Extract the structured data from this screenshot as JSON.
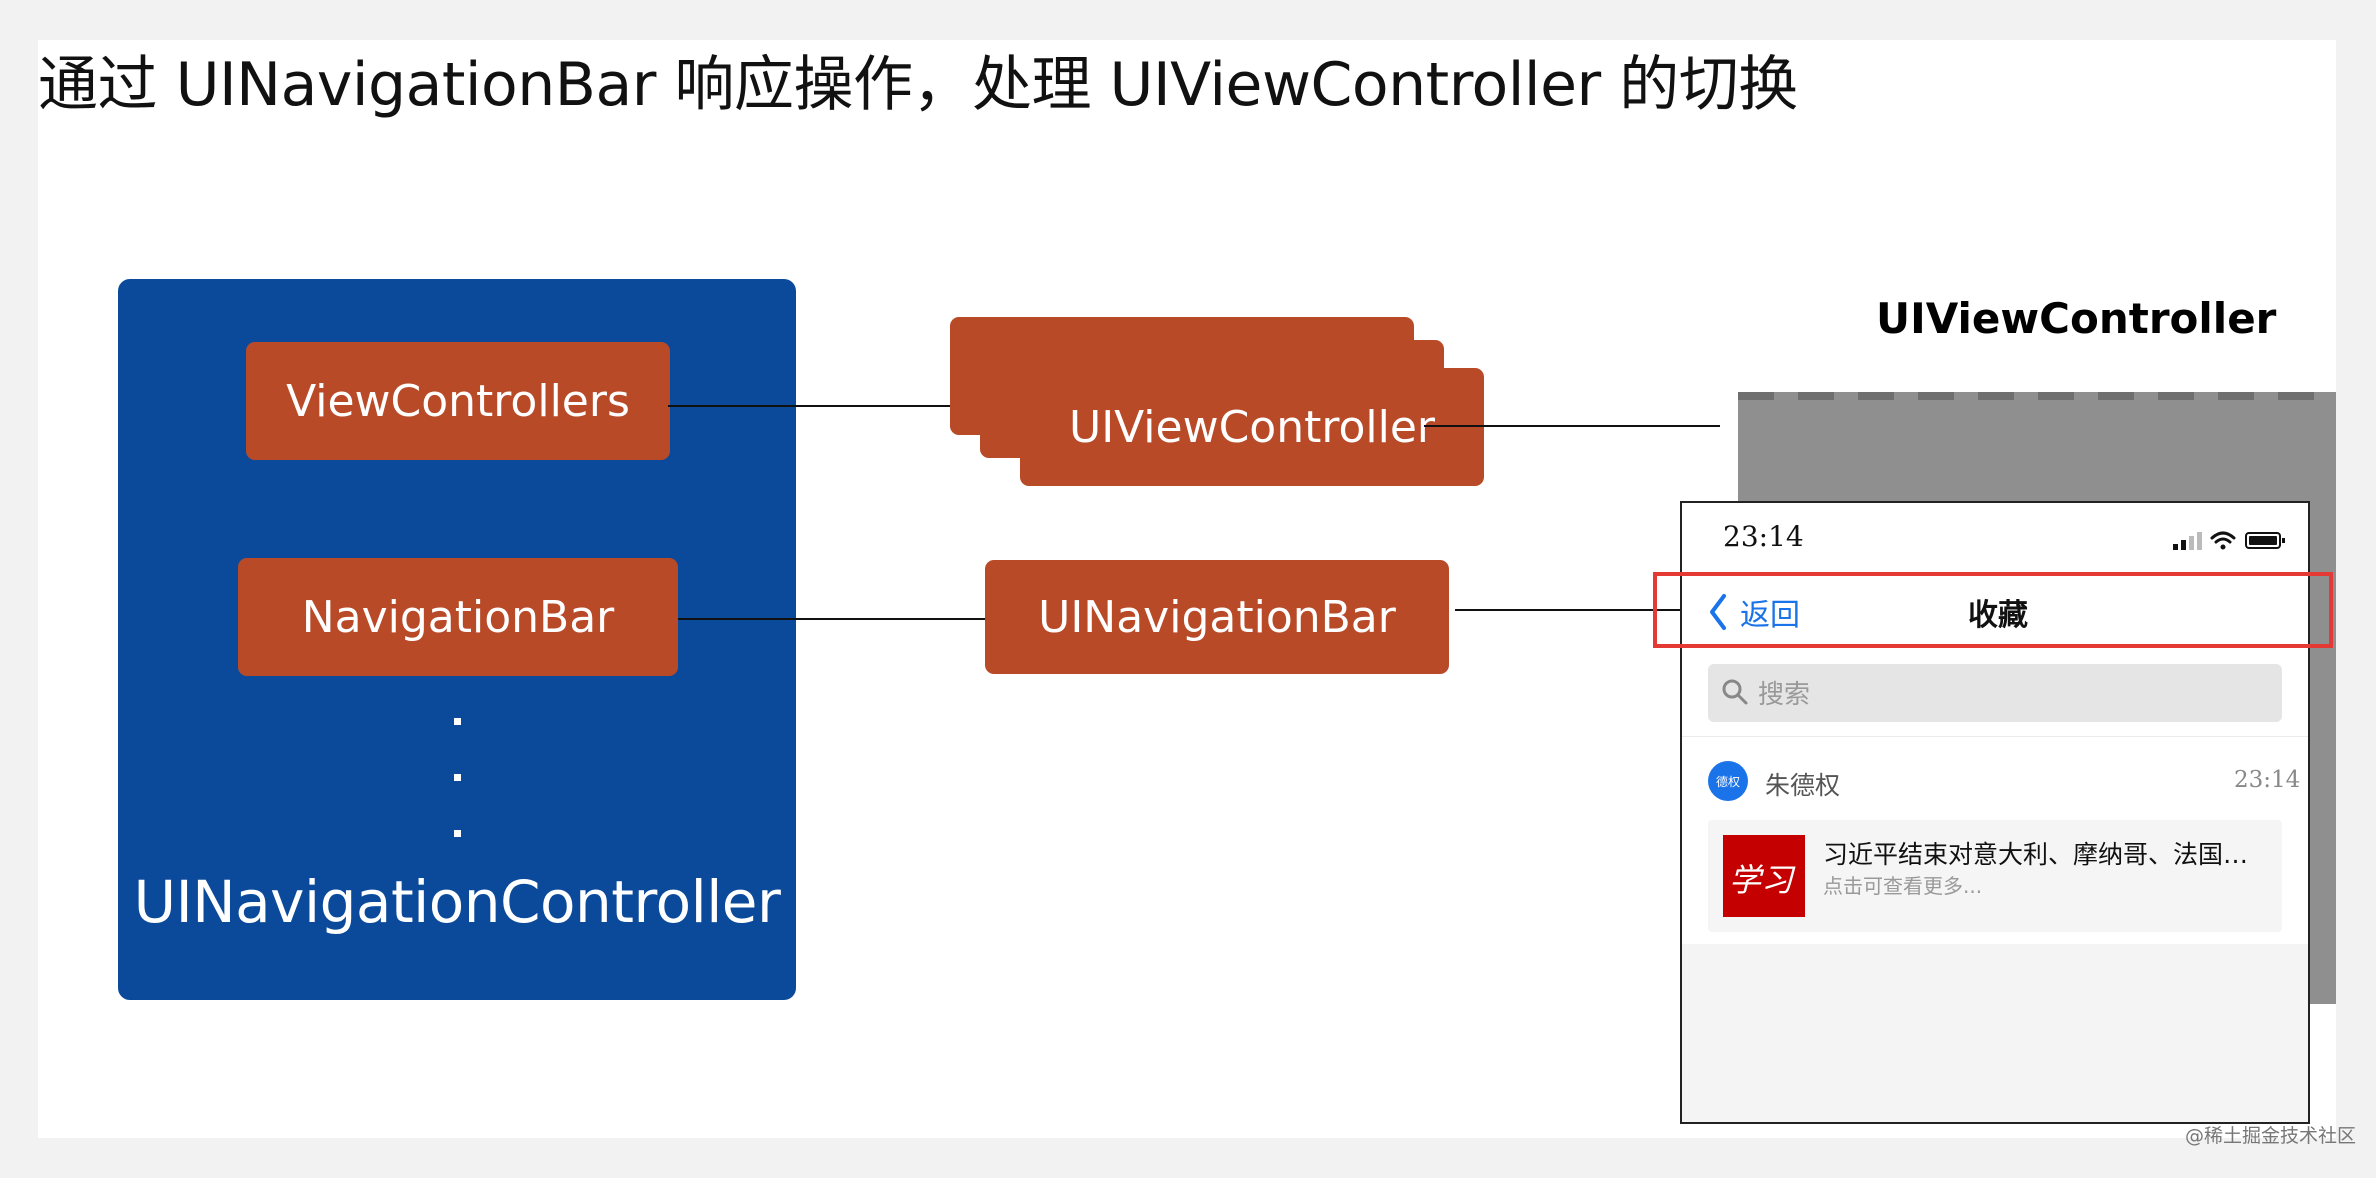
{
  "title": "通过 UINavigationBar 响应操作，处理 UIViewController 的切换",
  "controller": {
    "label": "UINavigationController",
    "items": [
      "ViewControllers",
      "NavigationBar"
    ],
    "ellipsis": "⋮"
  },
  "middle": {
    "view_controller": "UIViewController",
    "navigation_bar": "UINavigationBar"
  },
  "right": {
    "heading": "UIViewController",
    "phone": {
      "status_time": "23:14",
      "back_label": "返回",
      "nav_title": "收藏",
      "search_placeholder": "搜索",
      "avatar_text": "德权",
      "sender": "朱德权",
      "message_time": "23:14",
      "card_title": "习近平结束对意大利、摩纳哥、法国…",
      "card_subtitle": "点击可查看更多...",
      "thumb_text": "学习"
    }
  },
  "watermark": "@稀土掘金技术社区",
  "colors": {
    "controller_bg": "#0b4a9a",
    "box": "#b94a28",
    "highlight": "#e53935",
    "link": "#1a73e8"
  }
}
